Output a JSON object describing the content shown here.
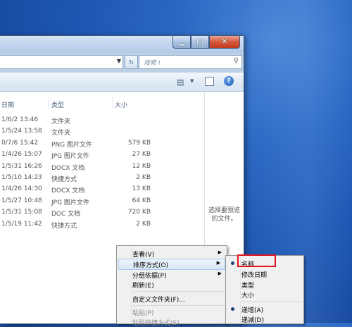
{
  "search": {
    "placeholder": "搜索 I"
  },
  "columns": {
    "date": "日期",
    "type": "类型",
    "size": "大小"
  },
  "files": [
    {
      "date": "1/6/2 13:46",
      "type": "文件夹",
      "size": ""
    },
    {
      "date": "1/5/24 13:58",
      "type": "文件夹",
      "size": ""
    },
    {
      "date": "0/7/6 15:42",
      "type": "PNG 图片文件",
      "size": "579 KB"
    },
    {
      "date": "1/4/26 15:07",
      "type": "JPG 图片文件",
      "size": "27 KB"
    },
    {
      "date": "1/5/31 16:26",
      "type": "DOCX 文档",
      "size": "12 KB"
    },
    {
      "date": "1/5/10 14:23",
      "type": "快捷方式",
      "size": "2 KB"
    },
    {
      "date": "1/4/26 14:30",
      "type": "DOCX 文档",
      "size": "13 KB"
    },
    {
      "date": "1/5/27 10:48",
      "type": "JPG 图片文件",
      "size": "64 KB"
    },
    {
      "date": "1/5/31 15:08",
      "type": "DOC 文档",
      "size": "720 KB"
    },
    {
      "date": "1/5/19 11:42",
      "type": "快捷方式",
      "size": "2 KB"
    }
  ],
  "preview_pane": {
    "line1": "选择要预览",
    "line2": "的文件。"
  },
  "context_menu": {
    "view": "查看(V)",
    "sort_by": "排序方式(O)",
    "group_by": "分组依据(P)",
    "refresh": "刷新(E)",
    "customize": "自定义文件夹(F)...",
    "paste": "粘贴(P)",
    "paste_shortcut": "粘贴快捷方式(S)"
  },
  "sort_submenu": {
    "name": "名称",
    "date_modified": "修改日期",
    "type": "类型",
    "size": "大小",
    "ascending": "递增(A)",
    "descending": "递减(D)"
  },
  "icons": {
    "address_dropdown": "chevron-down-icon",
    "refresh": "refresh-icon",
    "search": "search-icon",
    "views": "views-icon",
    "preview": "preview-pane-icon",
    "help": "help-icon"
  }
}
